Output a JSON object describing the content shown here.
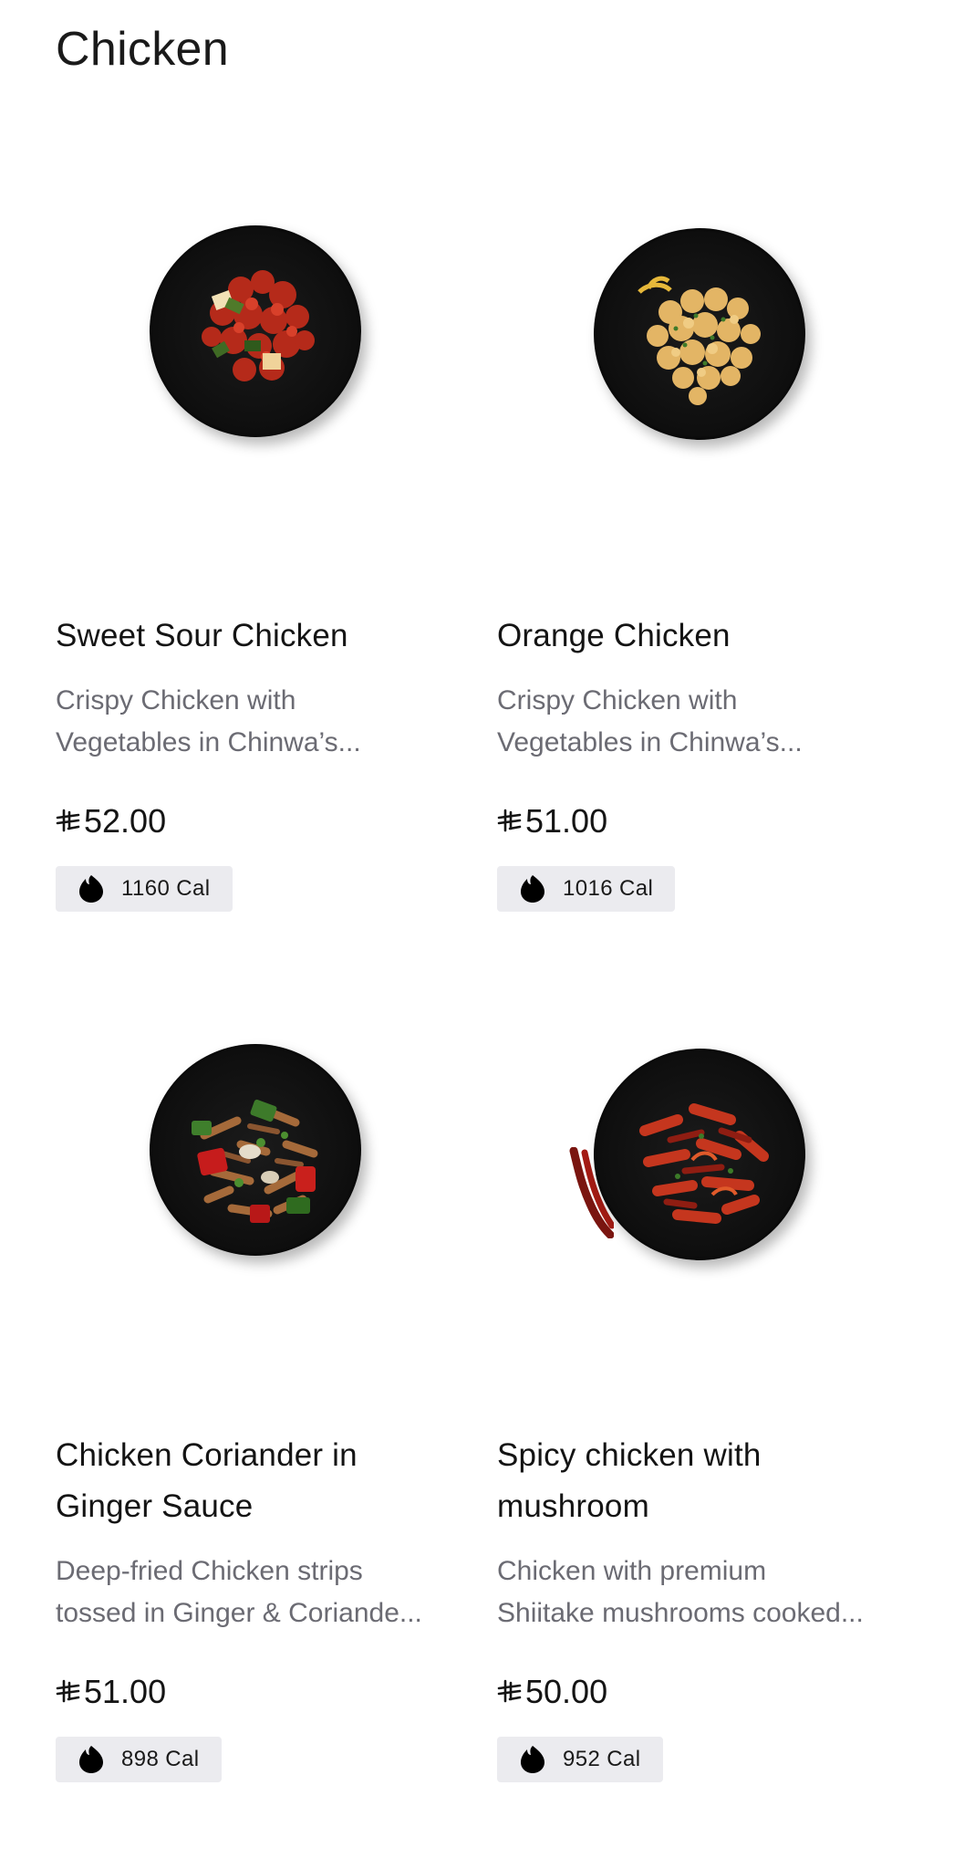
{
  "section": {
    "title": "Chicken"
  },
  "items": [
    {
      "name_lines": [
        "Sweet Sour Chicken"
      ],
      "desc_lines": [
        "Crispy Chicken with",
        "Vegetables in Chinwa’s..."
      ],
      "price": "52.00",
      "calories": "1160 Cal",
      "image": "sweet-sour-chicken-dish"
    },
    {
      "name_lines": [
        "Orange Chicken"
      ],
      "desc_lines": [
        "Crispy Chicken with",
        "Vegetables in Chinwa’s..."
      ],
      "price": "51.00",
      "calories": "1016 Cal",
      "image": "orange-chicken-dish"
    },
    {
      "name_lines": [
        "Chicken Coriander in",
        "Ginger Sauce"
      ],
      "desc_lines": [
        "Deep-fried Chicken strips",
        "tossed in Ginger & Coriande..."
      ],
      "price": "51.00",
      "calories": "898 Cal",
      "image": "chicken-coriander-dish"
    },
    {
      "name_lines": [
        "Spicy chicken with",
        "mushroom"
      ],
      "desc_lines": [
        "Chicken with premium",
        "Shiitake mushrooms cooked..."
      ],
      "price": "50.00",
      "calories": "952 Cal",
      "image": "spicy-chicken-mushroom-dish"
    }
  ],
  "icons": {
    "currency": "saudi-riyal-icon",
    "calories": "flame-icon"
  },
  "colors": {
    "badge_bg": "#ebebef",
    "description": "#6b6b73",
    "plate": "#0e0e0e"
  }
}
